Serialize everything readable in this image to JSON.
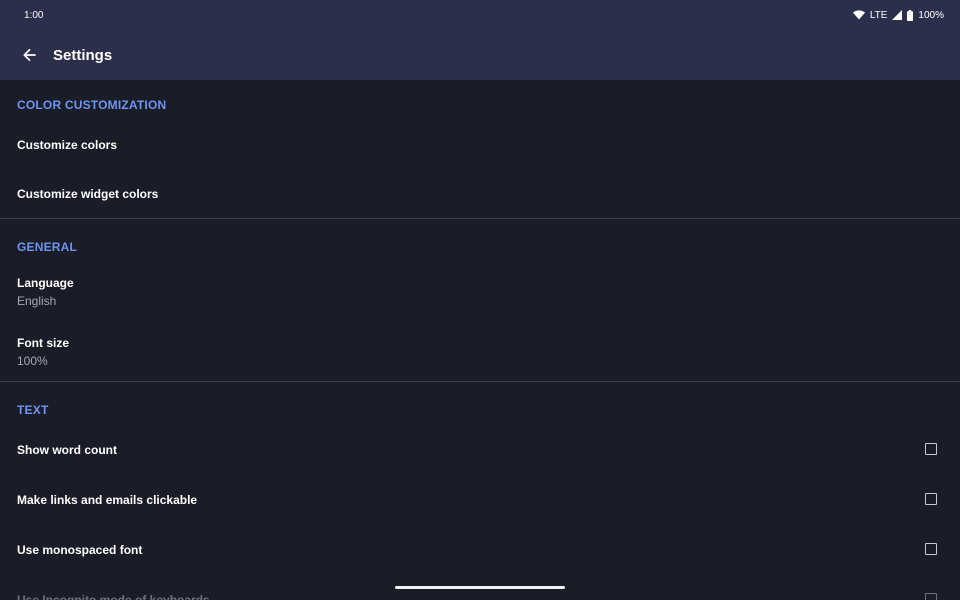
{
  "status_bar": {
    "time": "1:00",
    "network": "LTE",
    "battery": "100%",
    "icons": [
      "wifi-icon",
      "signal-icon",
      "battery-icon"
    ]
  },
  "app_bar": {
    "title": "Settings",
    "back_icon": "arrow-back-icon"
  },
  "sections": {
    "color": {
      "header": "COLOR CUSTOMIZATION",
      "customize_colors": "Customize colors",
      "customize_widget_colors": "Customize widget colors"
    },
    "general": {
      "header": "GENERAL",
      "language_title": "Language",
      "language_value": "English",
      "font_size_title": "Font size",
      "font_size_value": "100%"
    },
    "text": {
      "header": "TEXT",
      "show_word_count": "Show word count",
      "show_word_count_checked": false,
      "clickable_links": "Make links and emails clickable",
      "clickable_links_checked": false,
      "monospaced_font": "Use monospaced font",
      "monospaced_font_checked": false,
      "incognito_keyboard": "Use Incognito mode of keyboards",
      "incognito_keyboard_checked": false
    }
  },
  "colors": {
    "background": "#1a1c28",
    "app_bar": "#2c2f4c",
    "accent": "#6e95ef",
    "divider": "#3a3c4a"
  }
}
